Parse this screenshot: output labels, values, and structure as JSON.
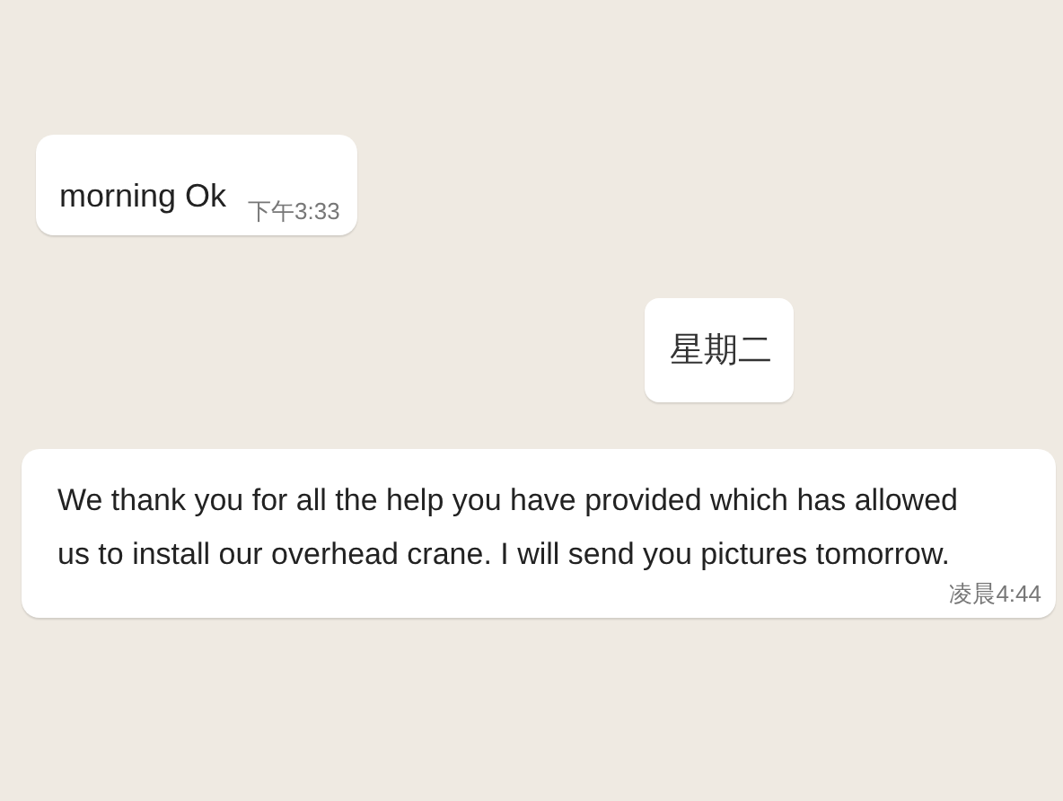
{
  "messages": [
    {
      "kind": "message",
      "text": "morning Ok",
      "time": "下午3:33"
    },
    {
      "kind": "date",
      "text": "星期二"
    },
    {
      "kind": "message",
      "text": "We thank you for all the help you have provided which has allowed us to install our overhead crane. I will send you pictures tomorrow.",
      "time": "凌晨4:44"
    }
  ]
}
